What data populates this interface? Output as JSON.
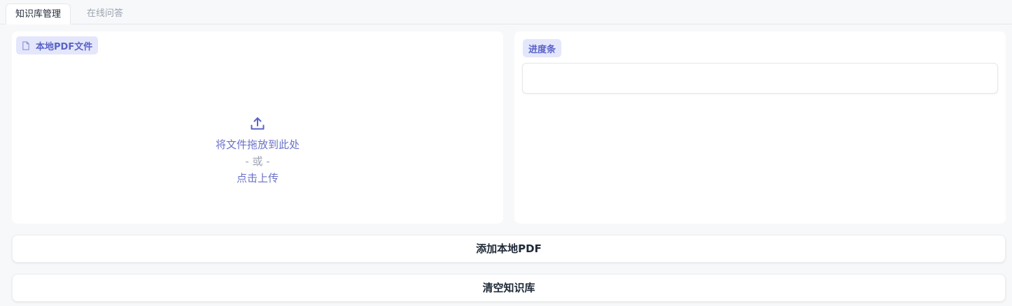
{
  "tabs": [
    {
      "label": "知识库管理",
      "active": true
    },
    {
      "label": "在线问答",
      "active": false
    }
  ],
  "upload_panel": {
    "label": "本地PDF文件",
    "label_icon": "file-icon",
    "upload_icon": "upload-icon",
    "drop_text": "将文件拖放到此处",
    "or_text": "- 或 -",
    "click_text": "点击上传"
  },
  "progress_panel": {
    "label": "进度条",
    "value": ""
  },
  "buttons": {
    "add_label": "添加本地PDF",
    "clear_label": "清空知识库"
  },
  "colors": {
    "accent": "#5a63c7",
    "badge_bg": "#e4e7fb",
    "background": "#f7f8fa"
  }
}
